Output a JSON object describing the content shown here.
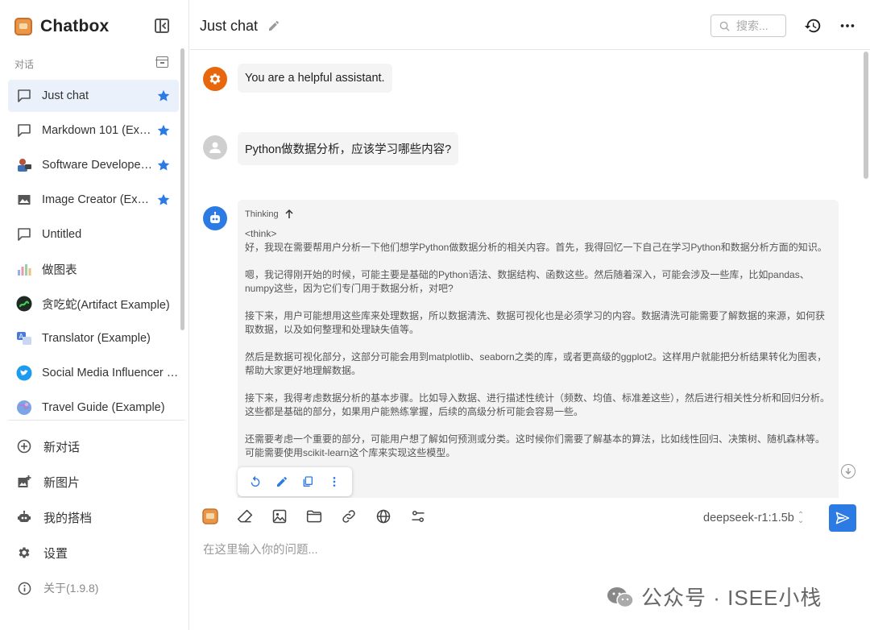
{
  "app": {
    "name": "Chatbox"
  },
  "sidebar": {
    "section_label": "对话",
    "conversations": [
      {
        "label": "Just chat",
        "icon": "chat-bubble-icon",
        "starred": true,
        "active": true
      },
      {
        "label": "Markdown 101 (Example)",
        "icon": "chat-bubble-icon",
        "starred": true
      },
      {
        "label": "Software Developer (Example)",
        "icon": "developer-avatar-icon",
        "starred": true
      },
      {
        "label": "Image Creator (Example)",
        "icon": "image-icon",
        "starred": true
      },
      {
        "label": "Untitled",
        "icon": "chat-bubble-icon",
        "starred": false
      },
      {
        "label": "做图表",
        "icon": "chart-avatar-icon",
        "starred": false
      },
      {
        "label": "贪吃蛇(Artifact Example)",
        "icon": "snake-avatar-icon",
        "starred": false
      },
      {
        "label": "Translator (Example)",
        "icon": "translator-avatar-icon",
        "starred": false
      },
      {
        "label": "Social Media Influencer (Example)",
        "icon": "twitter-avatar-icon",
        "starred": false
      },
      {
        "label": "Travel Guide (Example)",
        "icon": "globe-avatar-icon",
        "starred": false
      }
    ],
    "actions": [
      {
        "label": "新对话",
        "icon": "plus-circle-icon"
      },
      {
        "label": "新图片",
        "icon": "add-image-icon"
      },
      {
        "label": "我的搭档",
        "icon": "robot-icon"
      },
      {
        "label": "设置",
        "icon": "gear-icon"
      },
      {
        "label": "关于(1.9.8)",
        "icon": "info-icon"
      }
    ]
  },
  "header": {
    "title": "Just chat",
    "search_placeholder": "搜索..."
  },
  "messages": {
    "system": {
      "text": "You are a helpful assistant."
    },
    "user": {
      "text": "Python做数据分析，应该学习哪些内容?"
    },
    "assistant": {
      "thinking_label": "Thinking",
      "think_tag": "<think>",
      "paragraphs": [
        "好，我现在需要帮用户分析一下他们想学Python做数据分析的相关内容。首先，我得回忆一下自己在学习Python和数据分析方面的知识。",
        "嗯，我记得刚开始的时候，可能主要是基础的Python语法、数据结构、函数这些。然后随着深入，可能会涉及一些库，比如pandas、numpy这些，因为它们专门用于数据分析，对吧?",
        "接下来，用户可能想用这些库来处理数据，所以数据清洗、数据可视化也是必须学习的内容。数据清洗可能需要了解数据的来源，如何获取数据，以及如何整理和处理缺失值等。",
        "然后是数据可视化部分，这部分可能会用到matplotlib、seaborn之类的库，或者更高级的ggplot2。这样用户就能把分析结果转化为图表，帮助大家更好地理解数据。",
        "接下来，我得考虑数据分析的基本步骤。比如导入数据、进行描述性统计（频数、均值、标准差这些），然后进行相关性分析和回归分析。这些都是基础的部分，如果用户能熟练掌握，后续的高级分析可能会容易一些。",
        "还需要考虑一个重要的部分，可能用户想了解如何预测或分类。这时候你们需要了解基本的算法，比如线性回归、决策树、随机森林等。可能需要使用scikit-learn这个库来实现这些模型。"
      ]
    }
  },
  "composer": {
    "model": "deepseek-r1:1.5b",
    "placeholder": "在这里输入你的问题..."
  },
  "watermark": {
    "text": "公众号 · ISEE小栈"
  },
  "colors": {
    "accent": "#2c7be5",
    "system_avatar": "#e8660c",
    "user_avatar": "#cfcfcf",
    "assistant_avatar": "#2c7be5",
    "active_item_bg": "#eaf1fb"
  }
}
